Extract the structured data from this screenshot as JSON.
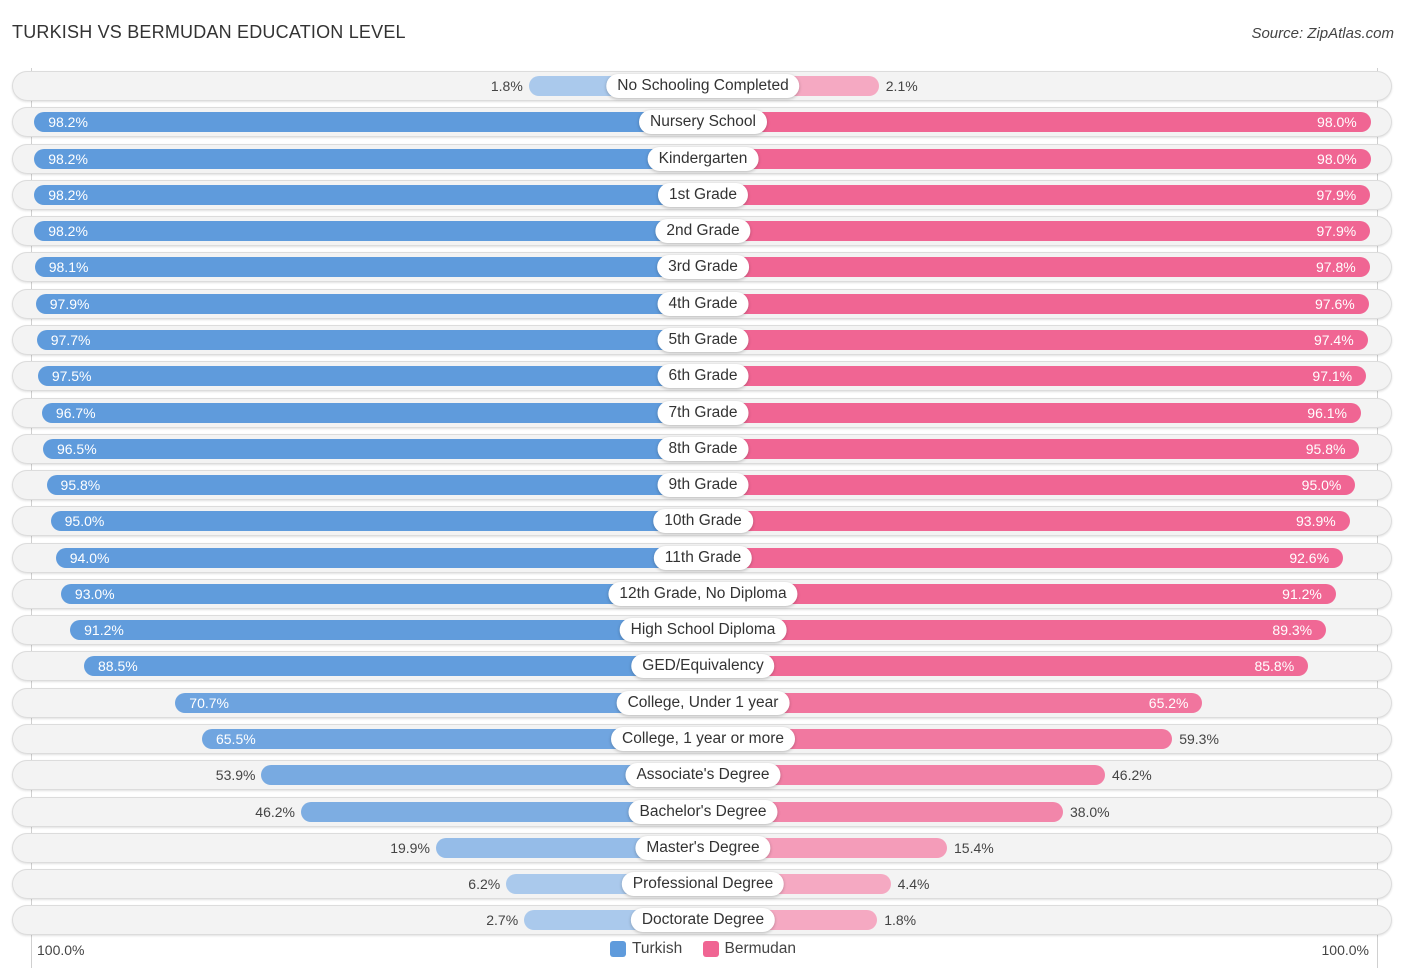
{
  "header": {
    "title": "TURKISH VS BERMUDAN EDUCATION LEVEL",
    "source": "Source: ZipAtlas.com"
  },
  "colors": {
    "turkish_strong": "#5f9bdc",
    "turkish_light": "#aac9ec",
    "bermudan_strong": "#f06593",
    "bermudan_light": "#f5a9c2",
    "track": "#f3f3f3"
  },
  "chart_data": {
    "type": "bar",
    "orientation": "horizontal-diverging",
    "title": "TURKISH VS BERMUDAN EDUCATION LEVEL",
    "xlabel": "",
    "ylabel": "",
    "xlim": [
      0,
      100
    ],
    "axis_left_label": "100.0%",
    "axis_right_label": "100.0%",
    "legend": {
      "position": "bottom-center",
      "entries": [
        "Turkish",
        "Bermudan"
      ]
    },
    "categories": [
      "No Schooling Completed",
      "Nursery School",
      "Kindergarten",
      "1st Grade",
      "2nd Grade",
      "3rd Grade",
      "4th Grade",
      "5th Grade",
      "6th Grade",
      "7th Grade",
      "8th Grade",
      "9th Grade",
      "10th Grade",
      "11th Grade",
      "12th Grade, No Diploma",
      "High School Diploma",
      "GED/Equivalency",
      "College, Under 1 year",
      "College, 1 year or more",
      "Associate's Degree",
      "Bachelor's Degree",
      "Master's Degree",
      "Professional Degree",
      "Doctorate Degree"
    ],
    "series": [
      {
        "name": "Turkish",
        "side": "left",
        "values": [
          1.8,
          98.2,
          98.2,
          98.2,
          98.2,
          98.1,
          97.9,
          97.7,
          97.5,
          96.7,
          96.5,
          95.8,
          95.0,
          94.0,
          93.0,
          91.2,
          88.5,
          70.7,
          65.5,
          53.9,
          46.2,
          19.9,
          6.2,
          2.7
        ],
        "labels": [
          "1.8%",
          "98.2%",
          "98.2%",
          "98.2%",
          "98.2%",
          "98.1%",
          "97.9%",
          "97.7%",
          "97.5%",
          "96.7%",
          "96.5%",
          "95.8%",
          "95.0%",
          "94.0%",
          "93.0%",
          "91.2%",
          "88.5%",
          "70.7%",
          "65.5%",
          "53.9%",
          "46.2%",
          "19.9%",
          "6.2%",
          "2.7%"
        ]
      },
      {
        "name": "Bermudan",
        "side": "right",
        "values": [
          2.1,
          98.0,
          98.0,
          97.9,
          97.9,
          97.8,
          97.6,
          97.4,
          97.1,
          96.1,
          95.8,
          95.0,
          93.9,
          92.6,
          91.2,
          89.3,
          85.8,
          65.2,
          59.3,
          46.2,
          38.0,
          15.4,
          4.4,
          1.8
        ],
        "labels": [
          "2.1%",
          "98.0%",
          "98.0%",
          "97.9%",
          "97.9%",
          "97.8%",
          "97.6%",
          "97.4%",
          "97.1%",
          "96.1%",
          "95.8%",
          "95.0%",
          "93.9%",
          "92.6%",
          "91.2%",
          "89.3%",
          "85.8%",
          "65.2%",
          "59.3%",
          "46.2%",
          "38.0%",
          "15.4%",
          "4.4%",
          "1.8%"
        ]
      }
    ]
  }
}
